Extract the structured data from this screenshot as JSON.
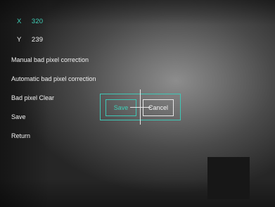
{
  "coords": {
    "x_label": "X",
    "x_value": "320",
    "y_label": "Y",
    "y_value": "239"
  },
  "menu": {
    "items": [
      {
        "label": "Manual bad pixel correction"
      },
      {
        "label": "Automatic bad pixel correction"
      },
      {
        "label": "Bad pixel Clear"
      },
      {
        "label": "Save"
      },
      {
        "label": "Return"
      }
    ]
  },
  "dialog": {
    "save_label": "Save",
    "cancel_label": "Cancel"
  },
  "colors": {
    "accent": "#3fd0b8",
    "text": "#f3f3f3"
  }
}
